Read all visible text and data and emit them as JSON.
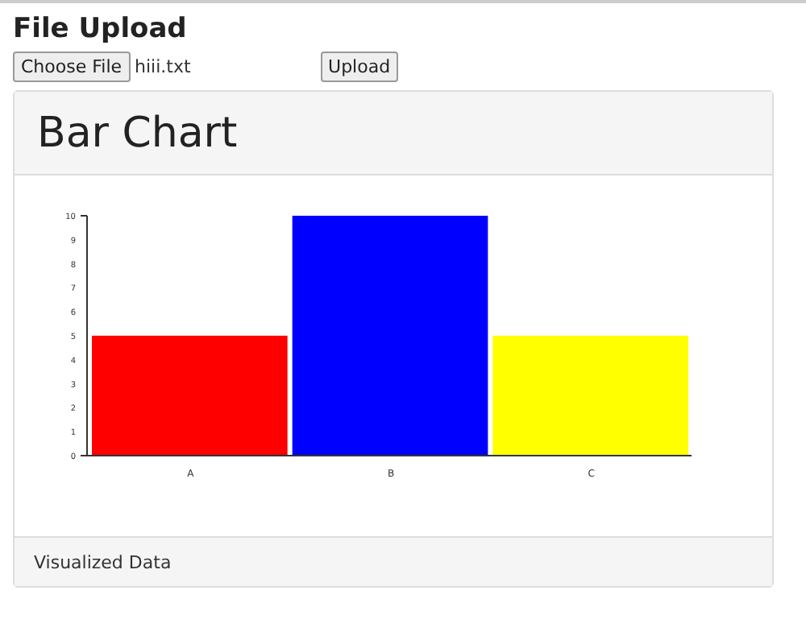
{
  "page": {
    "title": "File Upload"
  },
  "upload": {
    "choose_label": "Choose File",
    "file_name": "hiii.txt",
    "upload_label": "Upload"
  },
  "panel": {
    "title": "Bar Chart",
    "footer": "Visualized Data",
    "chart_data": {
      "type": "bar",
      "categories": [
        "A",
        "B",
        "C"
      ],
      "values": [
        5,
        10,
        5
      ],
      "colors": [
        "#ff0000",
        "#0000ff",
        "#ffff00"
      ],
      "ylim": [
        0,
        10
      ],
      "yticks": [
        0,
        1,
        2,
        3,
        4,
        5,
        6,
        7,
        8,
        9,
        10
      ]
    }
  }
}
